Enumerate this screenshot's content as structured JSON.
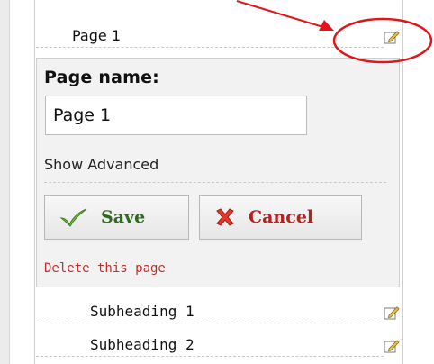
{
  "pages": {
    "top_item": {
      "label": "Page 1",
      "icon": "edit-icon"
    },
    "sub_items": [
      {
        "label": "Subheading 1",
        "icon": "edit-icon"
      },
      {
        "label": "Subheading 2",
        "icon": "edit-icon"
      }
    ]
  },
  "editor": {
    "title": "Page name:",
    "name_value": "Page 1",
    "show_advanced": "Show Advanced",
    "save_label": "Save",
    "cancel_label": "Cancel",
    "delete_label": "Delete this page"
  },
  "colors": {
    "annotation": "#e0161b",
    "save_text": "#2f6a1e",
    "cancel_text": "#b22222",
    "delete_text": "#c0302a"
  }
}
